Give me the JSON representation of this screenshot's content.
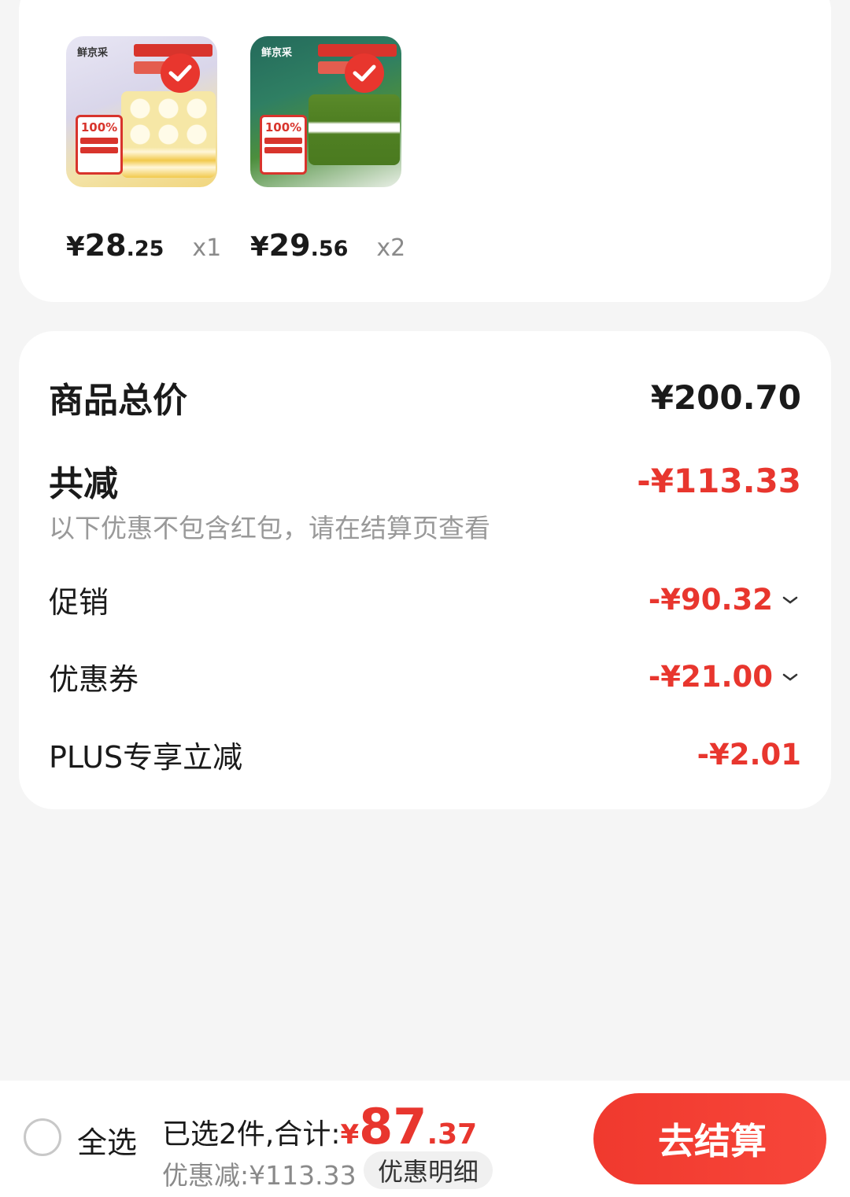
{
  "products": [
    {
      "brand": "鲜京采",
      "badge": "100%",
      "price_yen": "¥",
      "price_int": "28",
      "price_dec": ".25",
      "qty": "x1",
      "selected": true
    },
    {
      "brand": "鲜京采",
      "badge": "100%",
      "price_yen": "¥",
      "price_int": "29",
      "price_dec": ".56",
      "qty": "x2",
      "selected": true
    }
  ],
  "summary": {
    "total_label": "商品总价",
    "total_value": "¥200.70",
    "reduce_label": "共减",
    "reduce_value": "-¥113.33",
    "note": "以下优惠不包含红包，请在结算页查看",
    "items": [
      {
        "label": "促销",
        "value": "-¥90.32",
        "expandable": true
      },
      {
        "label": "优惠券",
        "value": "-¥21.00",
        "expandable": true
      },
      {
        "label": "PLUS专享立减",
        "value": "-¥2.01",
        "expandable": false
      }
    ]
  },
  "bottom_bar": {
    "select_all": "全选",
    "sum_label": "已选2件,合计:",
    "sum_yen": "¥",
    "sum_int": "87",
    "sum_dec": ".37",
    "discount_line": "优惠减:¥113.33",
    "detail_button": "优惠明细",
    "checkout_button": "去结算"
  },
  "colors": {
    "accent": "#e8362e",
    "muted": "#999999",
    "background": "#f5f5f5"
  }
}
